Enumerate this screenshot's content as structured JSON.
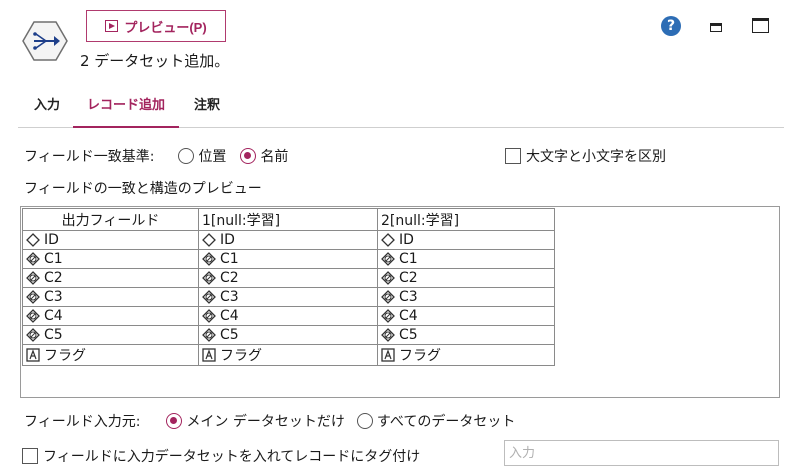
{
  "header": {
    "title": "2 データセット追加。",
    "preview_label": "プレビュー(P)",
    "help_label": "?"
  },
  "tabs": [
    {
      "label": "入力"
    },
    {
      "label": "レコード追加"
    },
    {
      "label": "注釈"
    }
  ],
  "match_criteria": {
    "label": "フィールド一致基準:",
    "options": [
      {
        "label": "位置",
        "checked": false
      },
      {
        "label": "名前",
        "checked": true
      }
    ],
    "case_sensitive_label": "大文字と小文字を区別"
  },
  "preview_section_label": "フィールドの一致と構造のプレビュー",
  "grid": {
    "columns": [
      "出力フィールド",
      "1[null:学習]",
      "2[null:学習]"
    ],
    "rows": [
      {
        "icon": "diamond-icon",
        "name": "ID"
      },
      {
        "icon": "continuous-icon",
        "name": "C1"
      },
      {
        "icon": "continuous-icon",
        "name": "C2"
      },
      {
        "icon": "continuous-icon",
        "name": "C3"
      },
      {
        "icon": "continuous-icon",
        "name": "C4"
      },
      {
        "icon": "continuous-icon",
        "name": "C5"
      },
      {
        "icon": "string-a-icon",
        "name": "フラグ"
      }
    ]
  },
  "field_source": {
    "label": "フィールド入力元:",
    "options": [
      {
        "label": "メイン データセットだけ",
        "checked": true
      },
      {
        "label": "すべてのデータセット",
        "checked": false
      }
    ]
  },
  "tag_records": {
    "label": "フィールドに入力データセットを入れてレコードにタグ付け",
    "input_placeholder": "入力"
  },
  "colors": {
    "accent": "#a3245e",
    "help": "#2d6db5"
  }
}
